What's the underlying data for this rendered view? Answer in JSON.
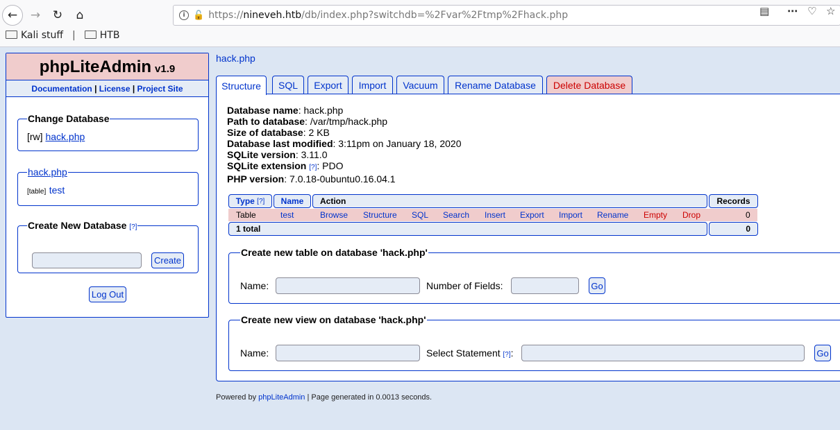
{
  "browser": {
    "url_protocol": "https://",
    "url_host": "nineveh.htb",
    "url_path": "/db/index.php?switchdb=%2Fvar%2Ftmp%2Fhack.php",
    "bookmarks": [
      {
        "label": "Kali stuff",
        "icon": "folder-icon"
      },
      {
        "label": "HTB",
        "icon": "folder-icon"
      }
    ],
    "bookmark_separator": "|"
  },
  "sidebar": {
    "app_name": "phpLiteAdmin",
    "version": "v1.9",
    "links": [
      "Documentation",
      "License",
      "Project Site"
    ],
    "link_separator": " | ",
    "change_db_legend": "Change Database",
    "change_db_mode": "[rw]",
    "change_db_name": "hack.php",
    "current_db_legend": "hack.php",
    "table_tag": "[table]",
    "table_name": "test",
    "create_db_legend": "Create New Database",
    "help_marker": "[?]",
    "create_button": "Create",
    "logout_button": "Log Out"
  },
  "main": {
    "title": "hack.php",
    "tabs": [
      {
        "label": "Structure",
        "active": true
      },
      {
        "label": "SQL"
      },
      {
        "label": "Export"
      },
      {
        "label": "Import"
      },
      {
        "label": "Vacuum"
      },
      {
        "label": "Rename Database"
      },
      {
        "label": "Delete Database",
        "danger": true
      }
    ],
    "info": [
      {
        "label": "Database name",
        "value": "hack.php"
      },
      {
        "label": "Path to database",
        "value": "/var/tmp/hack.php"
      },
      {
        "label": "Size of database",
        "value": "2 KB"
      },
      {
        "label": "Database last modified",
        "value": "3:11pm on January 18, 2020"
      },
      {
        "label": "SQLite version",
        "value": "3.11.0"
      },
      {
        "label": "SQLite extension",
        "value": "PDO",
        "help": "[?]"
      },
      {
        "label": "PHP version",
        "value": "7.0.18-0ubuntu0.16.04.1"
      }
    ],
    "table": {
      "headers": {
        "type": "Type",
        "type_help": "[?]",
        "name": "Name",
        "action": "Action",
        "records": "Records"
      },
      "rows": [
        {
          "type": "Table",
          "name": "test",
          "actions": [
            "Browse",
            "Structure",
            "SQL",
            "Search",
            "Insert",
            "Export",
            "Import",
            "Rename",
            "Empty",
            "Drop"
          ],
          "records": "0"
        }
      ],
      "footer_label": "1 total",
      "footer_records": "0"
    },
    "new_table": {
      "legend": "Create new table on database 'hack.php'",
      "name_label": "Name:",
      "fields_label": "Number of Fields:",
      "go_label": "Go"
    },
    "new_view": {
      "legend": "Create new view on database 'hack.php'",
      "name_label": "Name:",
      "statement_label": "Select Statement",
      "statement_help": "[?]",
      "statement_colon": ":",
      "go_label": "Go"
    }
  },
  "footer": {
    "prefix": "Powered by ",
    "link": "phpLiteAdmin",
    "suffix": " | Page generated in 0.0013 seconds."
  },
  "colors": {
    "accent": "#0033cc",
    "header_pink": "#f0cccc",
    "light_blue": "#e5ecf6",
    "page_bg": "#dce6f3",
    "danger": "#cc0000"
  }
}
